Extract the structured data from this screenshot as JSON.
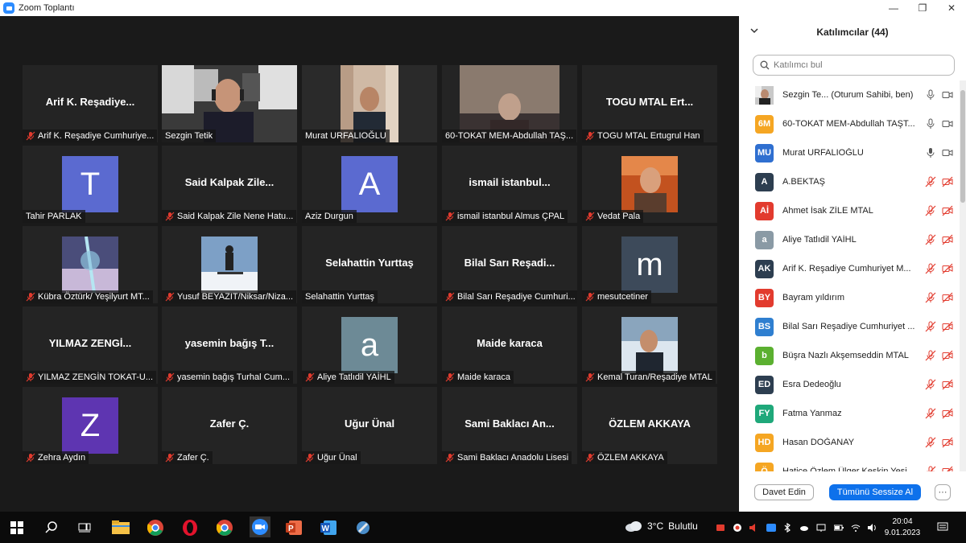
{
  "window": {
    "title": "Zoom Toplantı",
    "minimize": "—",
    "maximize": "❐",
    "close": "✕"
  },
  "tiles": [
    {
      "kind": "name",
      "big": "Arif K. Reşadiye...",
      "tag": "Arif K. Reşadiye Cumhuriye...",
      "muted": true
    },
    {
      "kind": "video",
      "tag": "Sezgin Tetik",
      "muted": false,
      "scene": "office"
    },
    {
      "kind": "video",
      "tag": "Murat URFALIOĞLU",
      "muted": false,
      "scene": "room",
      "active": true
    },
    {
      "kind": "video",
      "tag": "60-TOKAT MEM-Abdullah TAŞ...",
      "muted": false,
      "scene": "dark"
    },
    {
      "kind": "name",
      "big": "TOGU MTAL Ert...",
      "tag": "TOGU MTAL Ertugrul Han",
      "muted": true
    },
    {
      "kind": "avatar",
      "letter": "T",
      "color": "#5b6ad0",
      "tag": "Tahir PARLAK",
      "muted": false
    },
    {
      "kind": "name",
      "big": "Said Kalpak Zile...",
      "tag": "Said Kalpak Zile Nene Hatu...",
      "muted": true
    },
    {
      "kind": "avatar",
      "letter": "A",
      "color": "#5b6ad0",
      "tag": "Aziz Durgun",
      "muted": false
    },
    {
      "kind": "name",
      "big": "ismail istanbul...",
      "tag": "ismail istanbul Almus ÇPAL",
      "muted": true
    },
    {
      "kind": "photo",
      "tag": "Vedat Pala",
      "muted": true,
      "scene": "portrait-orange"
    },
    {
      "kind": "photo",
      "tag": "Kübra Öztürk/ Yeşilyurt MT...",
      "muted": true,
      "scene": "art"
    },
    {
      "kind": "photo",
      "tag": "Yusuf BEYAZIT/Niksar/Niza...",
      "muted": true,
      "scene": "snow"
    },
    {
      "kind": "name",
      "big": "Selahattin Yurttaş",
      "tag": "Selahattin Yurttaş",
      "muted": false
    },
    {
      "kind": "name",
      "big": "Bilal Sarı Reşadi...",
      "tag": "Bilal Sarı Reşadiye Cumhuri...",
      "muted": true
    },
    {
      "kind": "avatar",
      "letter": "m",
      "color": "#3d4a5a",
      "tag": "mesutcetiner",
      "muted": true
    },
    {
      "kind": "name",
      "big": "YILMAZ ZENGİ...",
      "tag": "YILMAZ ZENGİN   TOKAT-U...",
      "muted": true
    },
    {
      "kind": "name",
      "big": "yasemin bağış T...",
      "tag": "yasemin bağış Turhal Cum...",
      "muted": true
    },
    {
      "kind": "avatar",
      "letter": "a",
      "color": "#6d8a96",
      "tag": "Aliye Tatlıdil YAİHL",
      "muted": true
    },
    {
      "kind": "name",
      "big": "Maide karaca",
      "tag": "Maide karaca",
      "muted": true
    },
    {
      "kind": "photo",
      "tag": "Kemal Turan/Reşadiye MTAL",
      "muted": true,
      "scene": "portrait-snow"
    },
    {
      "kind": "avatar",
      "letter": "Z",
      "color": "#5e35b1",
      "tag": "Zehra Aydın",
      "muted": true
    },
    {
      "kind": "name",
      "big": "Zafer Ç.",
      "tag": "Zafer Ç.",
      "muted": true
    },
    {
      "kind": "name",
      "big": "Uğur Ünal",
      "tag": "Uğur Ünal",
      "muted": true
    },
    {
      "kind": "name",
      "big": "Sami Baklacı An...",
      "tag": "Sami Baklacı Anadolu Lisesi",
      "muted": true
    },
    {
      "kind": "name",
      "big": "ÖZLEM AKKAYA",
      "tag": "ÖZLEM AKKAYA",
      "muted": true
    }
  ],
  "panel": {
    "title": "Katılımcılar (44)",
    "search_placeholder": "Katılımcı bul",
    "invite": "Davet Edin",
    "mute_all": "Tümünü Sessize Al",
    "more": "···",
    "participants": [
      {
        "initials": "",
        "color": "#7a8796",
        "name": "Sezgin Te...  (Oturum Sahibi, ben)",
        "mic": "on",
        "cam": "on",
        "photo": true
      },
      {
        "initials": "6M",
        "color": "#f5a623",
        "name": "60-TOKAT MEM-Abdullah TAŞT...",
        "mic": "on",
        "cam": "on"
      },
      {
        "initials": "MU",
        "color": "#2f6fd0",
        "name": "Murat URFALIOĞLU",
        "mic": "active",
        "cam": "on"
      },
      {
        "initials": "A",
        "color": "#2d3e50",
        "name": "A.BEKTAŞ",
        "mic": "off",
        "cam": "off"
      },
      {
        "initials": "Aİ",
        "color": "#e23b2e",
        "name": "Ahmet İsak ZİLE MTAL",
        "mic": "off",
        "cam": "off"
      },
      {
        "initials": "a",
        "color": "#8a9aa5",
        "name": "Aliye Tatlıdil YAİHL",
        "mic": "off",
        "cam": "off"
      },
      {
        "initials": "AK",
        "color": "#2d3e50",
        "name": "Arif K. Reşadiye Cumhuriyet M...",
        "mic": "off",
        "cam": "off"
      },
      {
        "initials": "BY",
        "color": "#e23b2e",
        "name": "Bayram yıldırım",
        "mic": "off",
        "cam": "off"
      },
      {
        "initials": "BS",
        "color": "#2f7fd0",
        "name": "Bilal Sarı Reşadiye Cumhuriyet ...",
        "mic": "off",
        "cam": "off"
      },
      {
        "initials": "b",
        "color": "#5bb030",
        "name": "Büşra Nazlı Akşemseddin MTAL",
        "mic": "off",
        "cam": "off"
      },
      {
        "initials": "ED",
        "color": "#2d3e50",
        "name": "Esra Dedeoğlu",
        "mic": "off",
        "cam": "off"
      },
      {
        "initials": "FY",
        "color": "#1fa87a",
        "name": "Fatma Yanmaz",
        "mic": "off",
        "cam": "off"
      },
      {
        "initials": "HD",
        "color": "#f5a623",
        "name": "Hasan DOĞANAY",
        "mic": "off",
        "cam": "off"
      },
      {
        "initials": "Ö",
        "color": "#f5a623",
        "name": "Hatice Özlem Ülger Keskin Yeşi...",
        "mic": "off",
        "cam": "off"
      }
    ]
  },
  "taskbar": {
    "weather_temp": "3°C",
    "weather_text": "Bulutlu",
    "time": "20:04",
    "date": "9.01.2023"
  }
}
